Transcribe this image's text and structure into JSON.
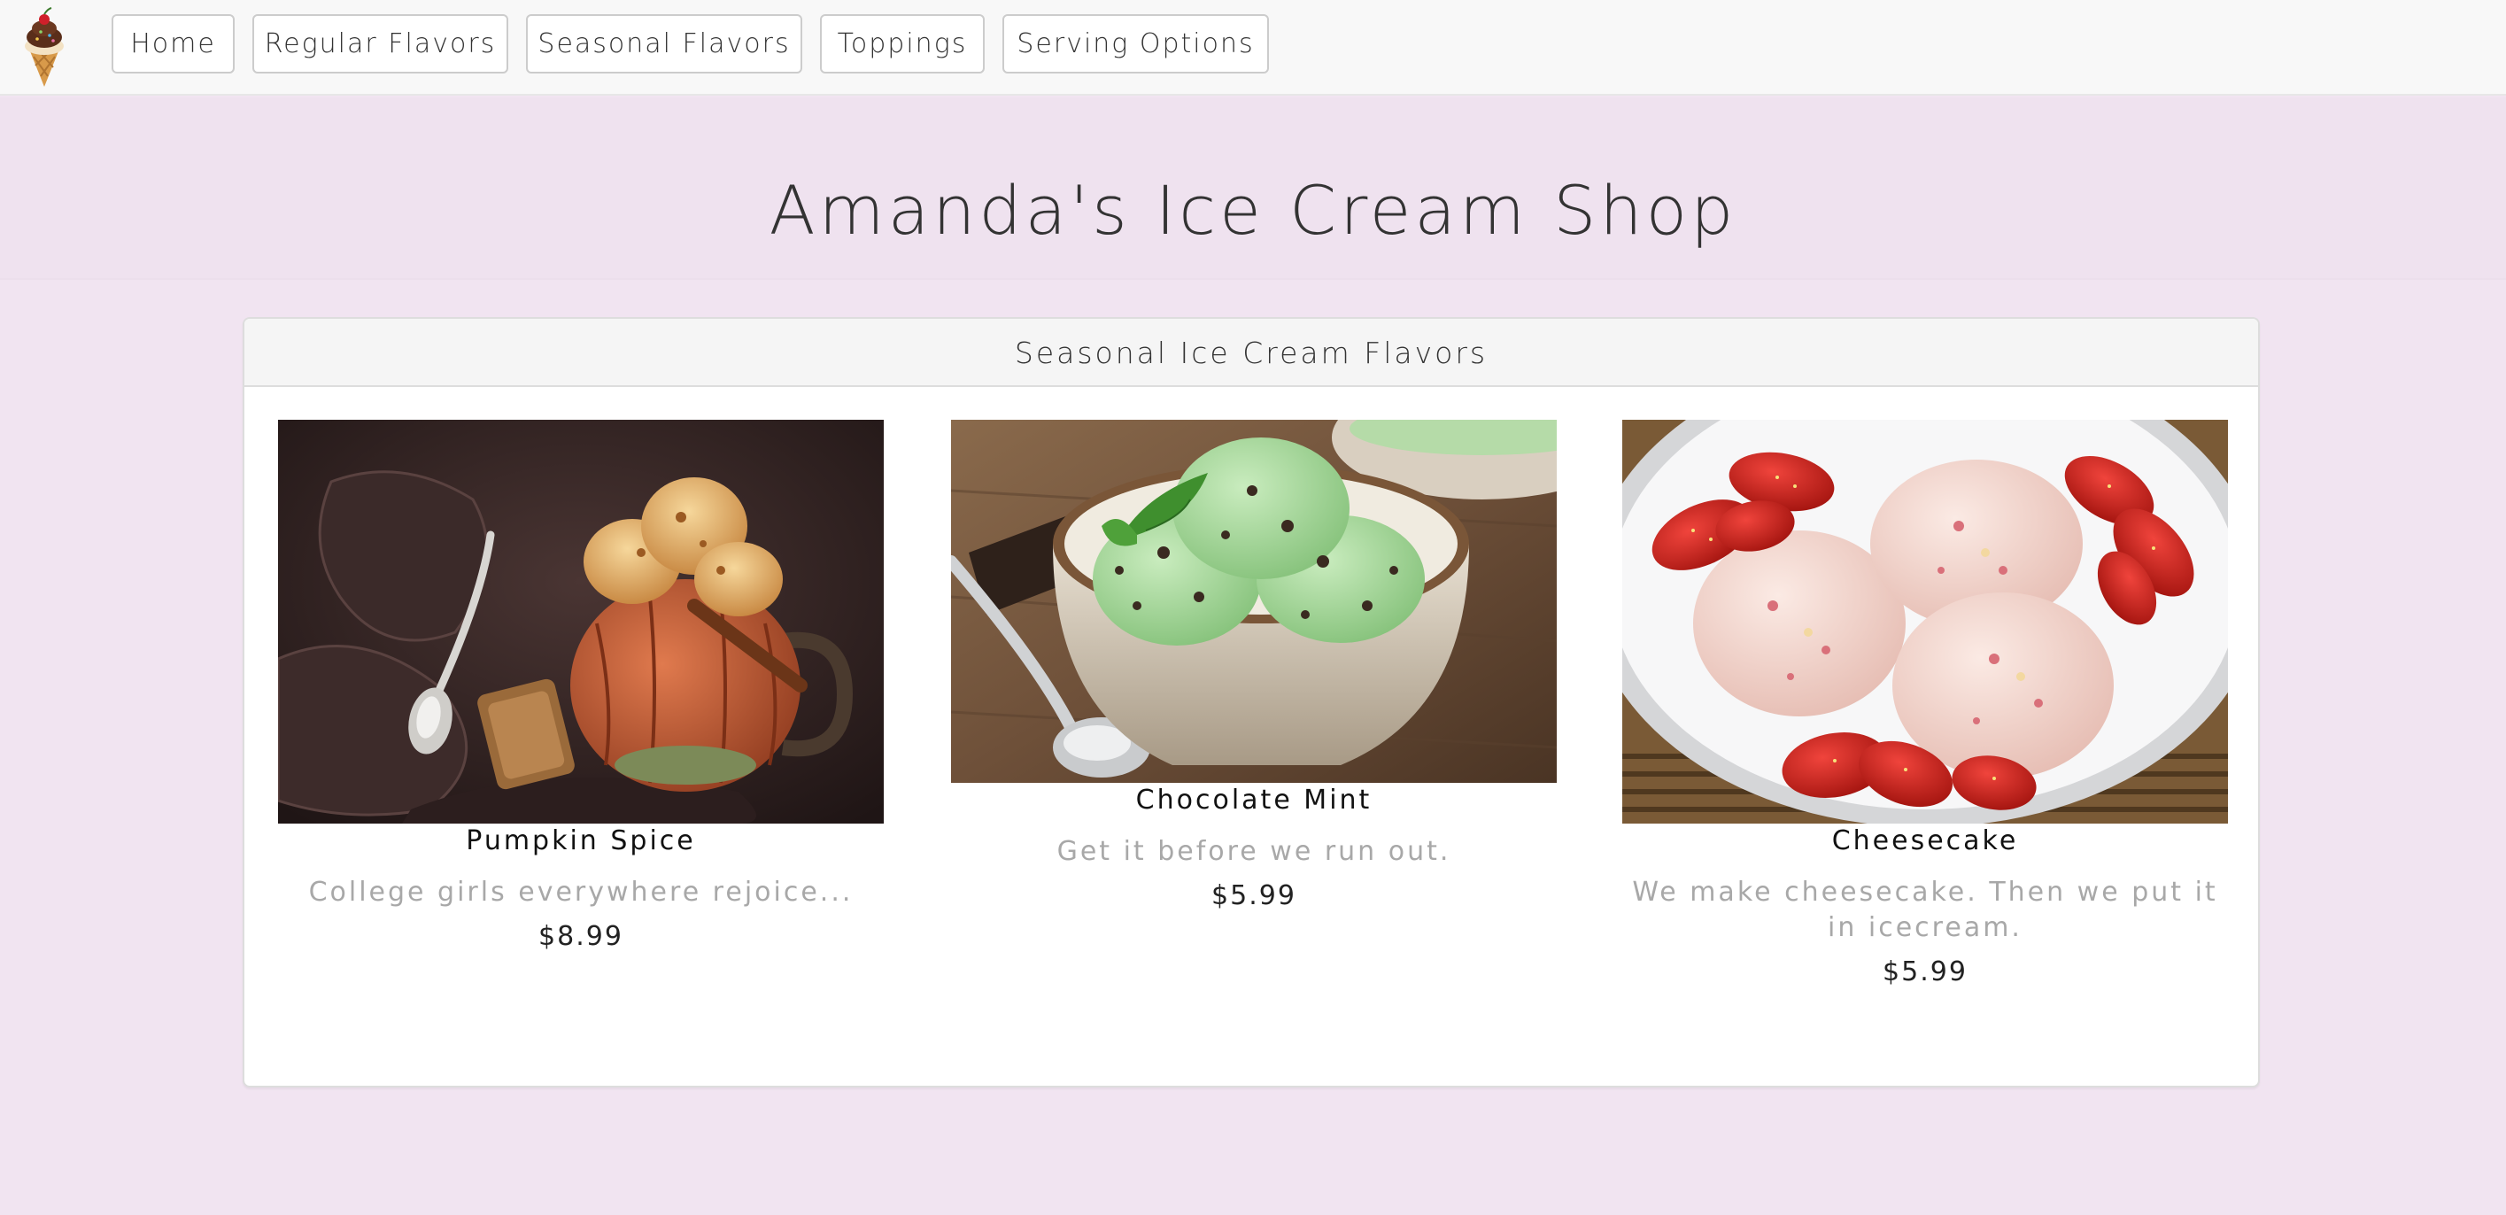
{
  "nav": {
    "logo_icon": "ice-cream-cone-icon",
    "items": [
      {
        "label": "Home"
      },
      {
        "label": "Regular Flavors"
      },
      {
        "label": "Seasonal Flavors"
      },
      {
        "label": "Toppings"
      },
      {
        "label": "Serving Options"
      }
    ]
  },
  "header": {
    "title": "Amanda's Ice Cream Shop"
  },
  "panel": {
    "heading": "Seasonal Ice Cream Flavors",
    "flavors": [
      {
        "name": "Pumpkin Spice",
        "description": "College girls everywhere rejoice...",
        "price": "$8.99",
        "photo": "pumpkin-mug-ice-cream-photo"
      },
      {
        "name": "Chocolate Mint",
        "description": "Get it before we run out.",
        "price": "$5.99",
        "photo": "mint-chip-bowl-photo"
      },
      {
        "name": "Cheesecake",
        "description": "We make cheesecake. Then we put it in icecream.",
        "price": "$5.99",
        "photo": "strawberry-cheesecake-bowl-photo"
      }
    ]
  },
  "colors": {
    "page_background": "#f1e4f1",
    "navbar_background": "#f8f8f8",
    "panel_heading_background": "#f5f5f5",
    "description_text": "#a8a8a8"
  }
}
